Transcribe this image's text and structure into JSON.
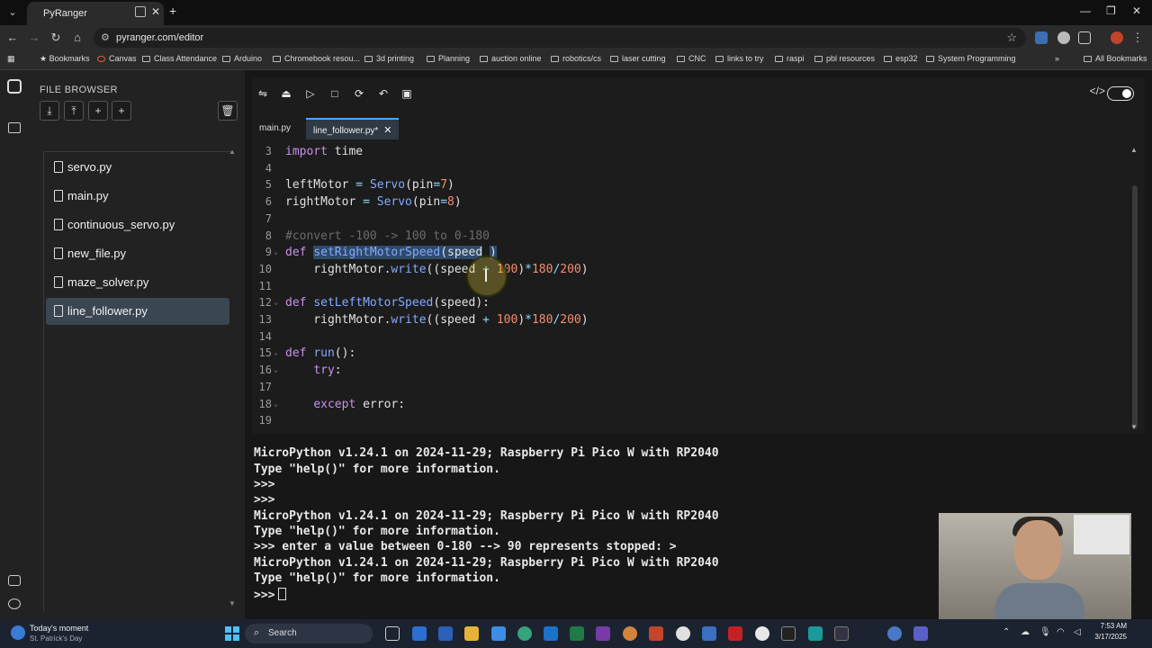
{
  "browser": {
    "tab_title": "PyRanger",
    "url": "pyranger.com/editor",
    "new_tab": "+",
    "close": "✕"
  },
  "bookmarks": [
    "Bookmarks",
    "Canvas",
    "Class Attendance",
    "Arduino",
    "Chromebook resou...",
    "3d printing",
    "Planning",
    "auction online",
    "robotics/cs",
    "laser cutting",
    "CNC",
    "links to try",
    "raspi",
    "pbl resources",
    "esp32",
    "System Programming"
  ],
  "bookmarks_more": "»",
  "all_bookmarks": "All Bookmarks",
  "sidebar": {
    "title": "FILE BROWSER",
    "files": [
      "servo.py",
      "main.py",
      "continuous_servo.py",
      "new_file.py",
      "maze_solver.py",
      "line_follower.py"
    ],
    "active_file": "line_follower.py"
  },
  "editor": {
    "tabs": [
      "main.py",
      "line_follower.py*"
    ],
    "active_tab": "line_follower.py*",
    "line_numbers": [
      "3",
      "4",
      "5",
      "6",
      "7",
      "8",
      "9",
      "10",
      "11",
      "12",
      "13",
      "14",
      "15",
      "16",
      "17",
      "18",
      "19"
    ]
  },
  "terminal": {
    "lines": [
      "MicroPython v1.24.1 on 2024-11-29; Raspberry Pi Pico W with RP2040",
      "Type \"help()\" for more information.",
      ">>>",
      ">>>",
      "MicroPython v1.24.1 on 2024-11-29; Raspberry Pi Pico W with RP2040",
      "Type \"help()\" for more information.",
      ">>> enter a value between 0-180 --> 90 represents stopped: >",
      "MicroPython v1.24.1 on 2024-11-29; Raspberry Pi Pico W with RP2040",
      "Type \"help()\" for more information.",
      ">>>"
    ]
  },
  "taskbar": {
    "weather_title": "Today's moment",
    "weather_sub": "St. Patrick's Day",
    "search_placeholder": "Search",
    "time": "7:53 AM",
    "date": "3/17/2025"
  },
  "colors": {
    "accent": "#4fa3ff",
    "keyword": "#c792ea",
    "function": "#82aaff",
    "number": "#f78c6c",
    "selection": "#2f4a6b",
    "active_file_bg": "#3b4653"
  }
}
